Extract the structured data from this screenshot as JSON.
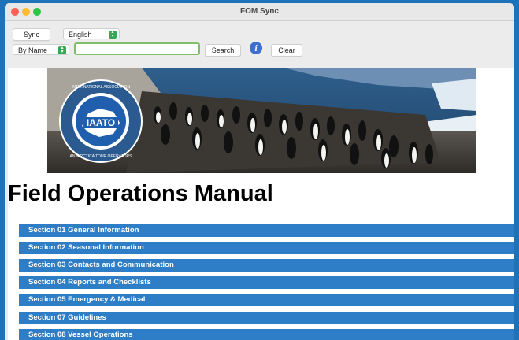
{
  "window": {
    "title": "FOM Sync"
  },
  "toolbar": {
    "sync_label": "Sync",
    "language_value": "English",
    "search_by_value": "By Name",
    "search_value": "",
    "search_label": "Search",
    "clear_label": "Clear"
  },
  "banner": {
    "logo_text": "IAATO",
    "ring_text_top": "INTERNATIONAL ASSOCIATION",
    "ring_text_bottom": "ANTARCTICA TOUR OPERATORS"
  },
  "page": {
    "heading": "Field Operations Manual"
  },
  "sections": [
    {
      "label": "Section 01 General Information"
    },
    {
      "label": "Section 02 Seasonal Information"
    },
    {
      "label": "Section 03 Contacts and Communication"
    },
    {
      "label": "Section 04 Reports and Checklists"
    },
    {
      "label": "Section 05 Emergency & Medical"
    },
    {
      "label": "Section 07 Guidelines"
    },
    {
      "label": "Section 08 Vessel Operations"
    }
  ],
  "colors": {
    "accent": "#2d7ec6",
    "frame": "#1e73b8",
    "focus": "#7fbf6a",
    "info": "#3d6fd1"
  },
  "icons": [
    "close-icon",
    "minimize-icon",
    "zoom-icon",
    "select-arrows-icon",
    "info-icon",
    "iaato-logo"
  ]
}
